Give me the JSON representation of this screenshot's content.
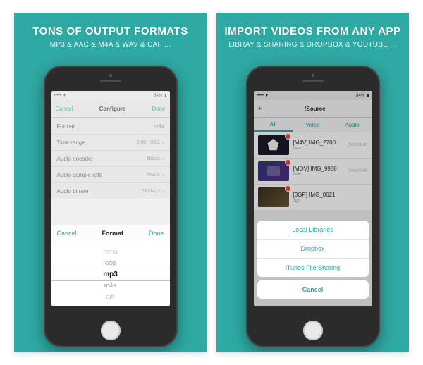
{
  "left_card": {
    "title": "TONS OF OUTPUT FORMATS",
    "subtitle": "MP3 & AAC & M4A & WAV & CAF ..."
  },
  "right_card": {
    "title": "IMPORT VIDEOS FROM ANY APP",
    "subtitle": "LIBRAY & SHARING & DROPBOX & YOUTUBE ..."
  },
  "left_screen": {
    "status_time": "",
    "nav_cancel": "Cancel",
    "nav_title": "Configure",
    "nav_done": "Done",
    "rows": [
      {
        "label": "Format",
        "value": "m4a"
      },
      {
        "label": "Time range",
        "value": "0:00 - 0:01"
      },
      {
        "label": "Audio encoder",
        "value": "libaac"
      },
      {
        "label": "Audio sample rate",
        "value": "44100"
      },
      {
        "label": "Audio bitrate",
        "value": "128 kb/ps"
      }
    ],
    "picker": {
      "cancel": "Cancel",
      "title": "Format",
      "done": "Done",
      "options": [
        "mma",
        "ogg",
        "mp3",
        "m4a",
        "aiff"
      ],
      "selected_index": 2
    }
  },
  "right_screen": {
    "nav_back": "+",
    "nav_title": "!Source",
    "tabs": [
      "All",
      "Video",
      "Audio"
    ],
    "active_tab": 0,
    "items": [
      {
        "title": "[M4V] IMG_2700",
        "sub": "m4v",
        "meta": "0:00:01.00"
      },
      {
        "title": "[MOV] IMG_9988",
        "sub": "mov",
        "meta": "0:00:04.00"
      },
      {
        "title": "[3GP] IMG_0621",
        "sub": "3gp",
        "meta": ""
      }
    ],
    "action_sheet": {
      "options": [
        "Local Libraries",
        "Dropbox",
        "iTunes File Sharing"
      ],
      "cancel": "Cancel"
    }
  }
}
